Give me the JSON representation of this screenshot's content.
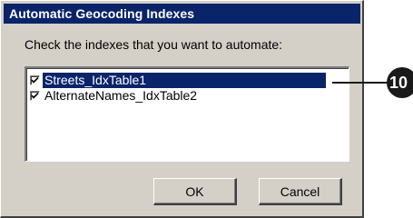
{
  "dialog": {
    "title": "Automatic Geocoding Indexes",
    "instruction": "Check the indexes that you want to automate:",
    "indexes": [
      {
        "label": "Streets_IdxTable1",
        "checked": true,
        "selected": true
      },
      {
        "label": "AlternateNames_IdxTable2",
        "checked": true,
        "selected": false
      }
    ],
    "ok_label": "OK",
    "cancel_label": "Cancel"
  },
  "callout": {
    "number": "10"
  },
  "colors": {
    "titlebar": "#0a246a",
    "dialog_bg": "#d4d0c8",
    "selection": "#0a246a",
    "callout": "#1a1a1a"
  }
}
